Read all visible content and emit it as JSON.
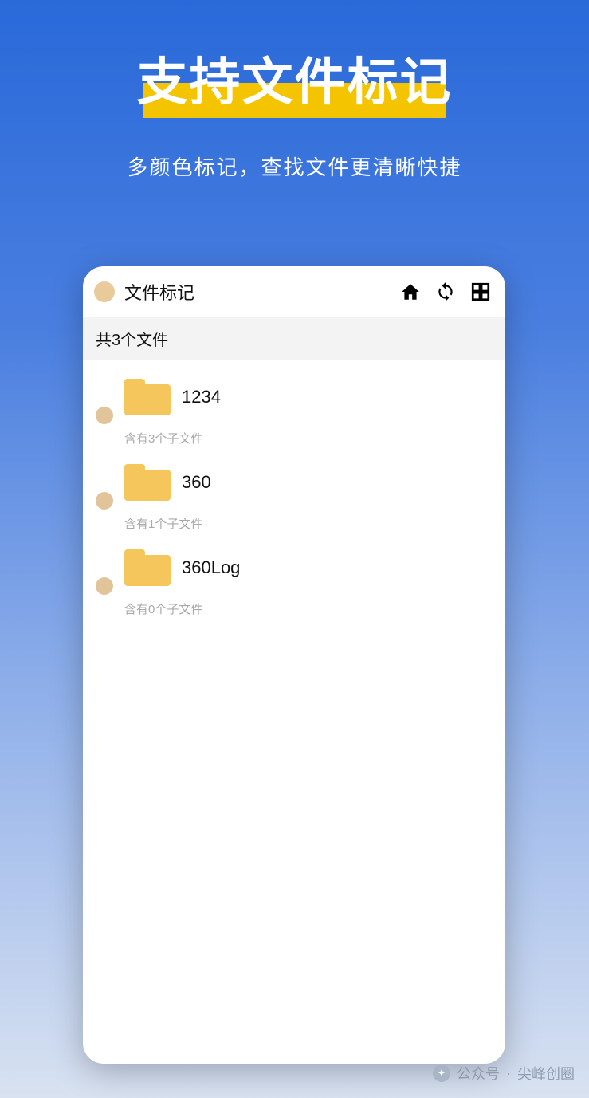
{
  "hero": {
    "title": "支持文件标记",
    "subtitle": "多颜色标记，查找文件更清晰快捷"
  },
  "app": {
    "topbar": {
      "title": "文件标记"
    },
    "summary": "共3个文件",
    "files": [
      {
        "name": "1234",
        "sub": "含有3个子文件"
      },
      {
        "name": "360",
        "sub": "含有1个子文件"
      },
      {
        "name": "360Log",
        "sub": "含有0个子文件"
      }
    ]
  },
  "watermark": {
    "label": "公众号",
    "sep": "·",
    "name": "尖峰创圈"
  }
}
